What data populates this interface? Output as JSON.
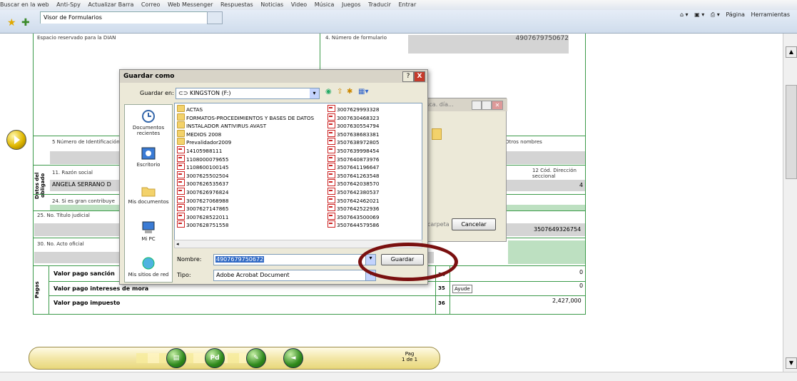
{
  "browser": {
    "links": [
      "Buscar en la web",
      "Anti-Spy",
      "Actualizar Barra",
      "Correo",
      "Web Messenger",
      "Respuestas",
      "Noticias",
      "Video",
      "Música",
      "Juegos",
      "Traducir",
      "Entrar"
    ],
    "tab_title": "Visor de Formularios",
    "cmd": {
      "page": "Página",
      "tools": "Herramientas"
    }
  },
  "form": {
    "header_left": "Espacio reservado para la DIAN",
    "header_right": "4. Número de formulario",
    "form_number": "4907679750672",
    "nit_label": "5 Número de Identificación Tributaria (NIT)",
    "otros_nombres": "Otros nombres",
    "section_obligado": "Datos del obligado",
    "razon_social_label": "11. Razón social",
    "razon_social_value": "ANGELA SERRANO D",
    "cod_dir_label": "12 Cód. Dirección seccional",
    "cod_dir_value": "4",
    "gran_contrib": "24. Si es gran contribuye",
    "titulo_judicial": "25. No. Título judicial",
    "titulo_value": "3507649326754",
    "acto_oficial": "30. No. Acto oficial",
    "section_pagos": "Pagos",
    "rows": [
      {
        "label": "Valor pago sanción",
        "num": "34",
        "value": "0"
      },
      {
        "label": "Valor pago intereses de mora",
        "num": "35",
        "value": "0"
      },
      {
        "label": "Valor pago impuesto",
        "num": "36",
        "value": "2,427,000"
      }
    ],
    "ayude": "Ayude"
  },
  "dialog": {
    "title": "Guardar como",
    "save_in_label": "Guardar en:",
    "save_in_value": "KINGSTON (F:)",
    "places": [
      "Documentos recientes",
      "Escritorio",
      "Mis documentos",
      "Mi PC",
      "Mis sitios de red"
    ],
    "files_col1": [
      {
        "name": "ACTAS",
        "type": "folder"
      },
      {
        "name": "FORMATOS-PROCEDIMIENTOS Y BASES DE DATOS",
        "type": "folder"
      },
      {
        "name": "INSTALADOR ANTIVIRUS AVAST",
        "type": "folder"
      },
      {
        "name": "MEDIOS 2008",
        "type": "folder"
      },
      {
        "name": "Prevalidador2009",
        "type": "folder"
      },
      {
        "name": "14105988111",
        "type": "pdf"
      },
      {
        "name": "1108000079655",
        "type": "pdf"
      },
      {
        "name": "1108600100145",
        "type": "pdf"
      },
      {
        "name": "3007625502504",
        "type": "pdf"
      },
      {
        "name": "3007626535637",
        "type": "pdf"
      },
      {
        "name": "3007626976824",
        "type": "pdf"
      },
      {
        "name": "3007627068988",
        "type": "pdf"
      },
      {
        "name": "3007627147865",
        "type": "pdf"
      },
      {
        "name": "3007628522011",
        "type": "pdf"
      },
      {
        "name": "3007628751558",
        "type": "pdf"
      }
    ],
    "files_col2": [
      {
        "name": "3007629993328",
        "type": "pdf"
      },
      {
        "name": "3007630468323",
        "type": "pdf"
      },
      {
        "name": "3007630554794",
        "type": "pdf"
      },
      {
        "name": "3507638683381",
        "type": "pdf"
      },
      {
        "name": "3507638972805",
        "type": "pdf"
      },
      {
        "name": "3507639998454",
        "type": "pdf"
      },
      {
        "name": "3507640873976",
        "type": "pdf"
      },
      {
        "name": "3507641196647",
        "type": "pdf"
      },
      {
        "name": "3507641263548",
        "type": "pdf"
      },
      {
        "name": "3507642038570",
        "type": "pdf"
      },
      {
        "name": "3507642380537",
        "type": "pdf"
      },
      {
        "name": "3507642462021",
        "type": "pdf"
      },
      {
        "name": "3507642522936",
        "type": "pdf"
      },
      {
        "name": "3507643500069",
        "type": "pdf"
      },
      {
        "name": "3507644579586",
        "type": "pdf"
      }
    ],
    "name_label": "Nombre:",
    "name_value": "4907679750672",
    "type_label": "Tipo:",
    "type_value": "Adobe Acrobat Document",
    "save_button": "Guardar",
    "help_button": "?",
    "close_button": "X"
  },
  "behind_dialog": {
    "title": "isca. día...",
    "folder_button": "carpeta",
    "cancel_button": "Cancelar"
  },
  "nav": {
    "page_label": "Pag",
    "page_value": "1 de 1"
  }
}
